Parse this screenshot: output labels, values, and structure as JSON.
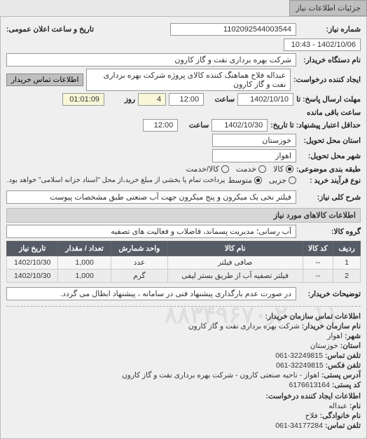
{
  "tab_title": "جزئیات اطلاعات نیاز",
  "fields": {
    "need_no_label": "شماره نیاز:",
    "need_no": "1102092544003544",
    "announce_dt_label": "تاریخ و ساعت اعلان عمومی:",
    "announce_dt": "1402/10/06 - 10:43",
    "buyer_org_label": "نام دستگاه خریدار:",
    "buyer_org": "شرکت بهره برداری نفت و گاز کارون",
    "requester_label": "ایجاد کننده درخواست:",
    "requester": "عبداله فلاح هماهنگ کننده کالای پروژه شرکت بهره برداری نفت و گاز کارون",
    "contact_btn": "اطلاعات تماس خریدار",
    "deadline_send_label": "مهلت ارسال پاسخ: تا",
    "deadline_date": "1402/10/10",
    "time_label": "ساعت",
    "deadline_time": "12:00",
    "days_label": "روز",
    "days_left": "4",
    "remaining_label": "ساعت باقی مانده",
    "remaining_time": "01:01:09",
    "validity_label": "حداقل اعتبار پیشنهاد: تا تاریخ:",
    "validity_date": "1402/10/30",
    "validity_time": "12:00",
    "province_label": "استان محل تحویل:",
    "province": "خوزستان",
    "city_label": "شهر محل تحویل:",
    "city": "اهواز",
    "class1_label": "طبقه بندی موضوعی:",
    "class1_goods": "کالا",
    "class1_service": "خدمت",
    "class1_goodsservice": "کالا/خدمت",
    "process_label": "نوع فرآیند خرید :",
    "proc_minor": "جزیی",
    "proc_medium": "متوسط",
    "proc_note": "پرداخت تمام یا بخشی از مبلغ خرید،از محل \"اسناد خزانه اسلامی\" خواهد بود.",
    "need_desc_label": "شرح کلی نیاز:",
    "need_desc": "فیلتر نخی یک میکرون و پنج میکرون جهت آب صنعتی طبق مشخصات پیوست",
    "goods_header": "اطلاعات کالاهای مورد نیاز",
    "group_label": "گروه کالا:",
    "group_value": "آب رسانی؛ مدیریت پسماند، فاضلاب و فعالیت های تصفیه",
    "buyer_notes_label": "توضیحات خریدار:",
    "buyer_notes": "در صورت عدم بارگذاری پیشنهاد فنی در سامانه ، پیشنهاد ابطال می گردد."
  },
  "table": {
    "headers": {
      "row": "ردیف",
      "code": "کد کالا",
      "name": "نام کالا",
      "unit": "واحد شمارش",
      "qty": "تعداد / مقدار",
      "date": "تاریخ نیاز"
    },
    "rows": [
      {
        "row": "1",
        "code": "--",
        "name": "صافی فیلتر",
        "unit": "عدد",
        "qty": "1,000",
        "date": "1402/10/30"
      },
      {
        "row": "2",
        "code": "--",
        "name": "فیلتر تصفیه آب از طریق بستر لیفی",
        "unit": "گرم",
        "qty": "1,000",
        "date": "1402/10/30"
      }
    ]
  },
  "contact": {
    "header": "اطلاعات تماس سازمان خریدار:",
    "org_label": "نام سازمان خریدار:",
    "org": "شرکت بهره برداری نفت و گاز کارون",
    "city_label": "شهر:",
    "city": "اهواز",
    "province_label": "استان:",
    "province": "خوزستان",
    "phone_label": "تلفن تماس:",
    "phone": "32249815-061",
    "fax_label": "تلفن فکس:",
    "fax": "32249815-061",
    "address_label": "آدرس پستی:",
    "address": "اهواز - ناحیه صنعتی کارون - شرکت بهره برداری نفت و گاز کارون",
    "postcode_label": "کد پستی:",
    "postcode": "6176613164",
    "creator_header": "اطلاعات ایجاد کننده درخواست:",
    "fname_label": "نام:",
    "fname": "عبداله",
    "lname_label": "نام خانوادگی:",
    "lname": "فلاح",
    "cphone_label": "تلفن تماس:",
    "cphone": "34177284-061"
  },
  "watermark": "۰۱۱–۸۸۳۴۹۶۷۰٫۲"
}
